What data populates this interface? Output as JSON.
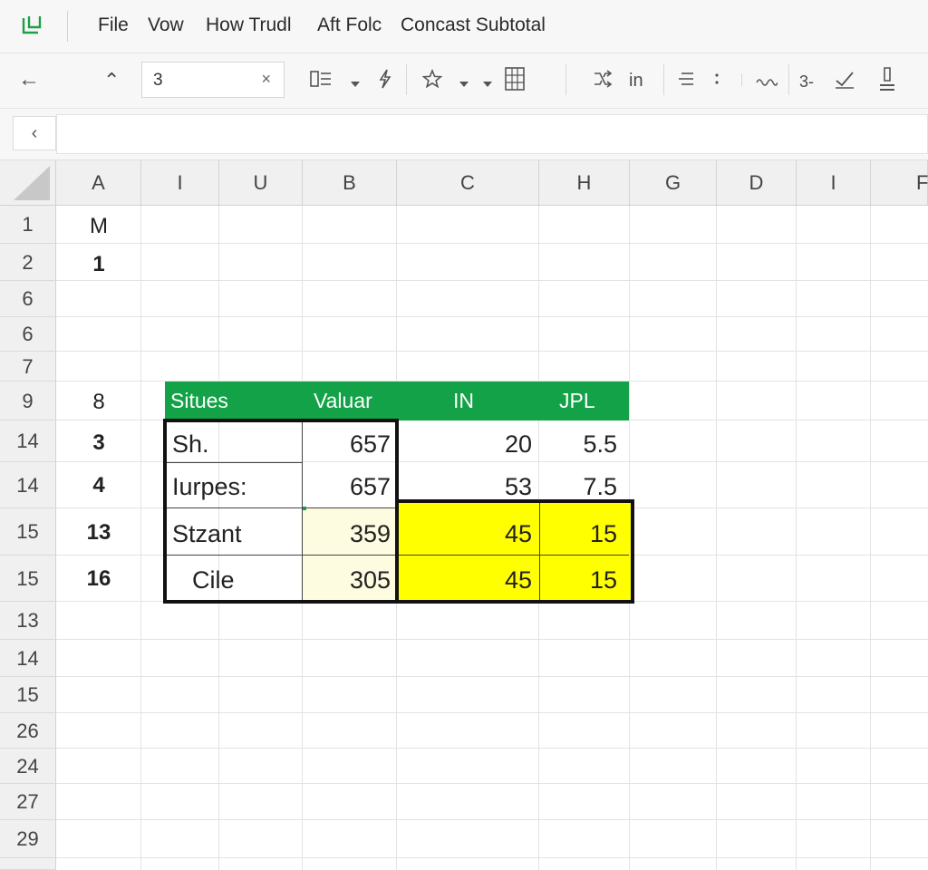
{
  "menubar": {
    "items": [
      "File",
      "Vow",
      "How Trudl",
      "Aft Folc",
      "Concast Subtotal"
    ]
  },
  "toolbar": {
    "back_icon": "←",
    "up_icon": "⌃",
    "name_box_value": "3",
    "name_box_clear": "×",
    "in_label": "in",
    "three_label": "3-"
  },
  "formula_bar": {
    "collapse_icon": "‹",
    "value": ""
  },
  "sheet": {
    "columns": [
      "A",
      "I",
      "U",
      "B",
      "C",
      "H",
      "G",
      "D",
      "I",
      "F"
    ],
    "rows": [
      "1",
      "2",
      "6",
      "6",
      "7",
      "9",
      "14",
      "14",
      "15",
      "15",
      "13",
      "14",
      "15",
      "26",
      "24",
      "27",
      "29"
    ],
    "col_a_values": [
      "M",
      "1",
      "",
      "",
      "",
      "8",
      "3",
      "4",
      "13",
      "16",
      "",
      "",
      "",
      "",
      "",
      "",
      ""
    ]
  },
  "table": {
    "headers": [
      "Situes",
      "Valuar",
      "IN",
      "JPL"
    ],
    "rows": [
      {
        "label": "Sh.",
        "value": "657",
        "in": "20",
        "jpl": "5.5"
      },
      {
        "label": "Iurpes:",
        "value": "657",
        "in": "53",
        "jpl": "7.5"
      },
      {
        "label": "Stzant",
        "value": "359",
        "in": "45",
        "jpl": "15"
      },
      {
        "label": "Cile",
        "value": "305",
        "in": "45",
        "jpl": "15"
      }
    ]
  },
  "colors": {
    "header_green": "#13a247",
    "highlight_yellow": "#ffff00",
    "cream_fill": "#fdfbe0",
    "logo_green": "#1f9f46"
  }
}
